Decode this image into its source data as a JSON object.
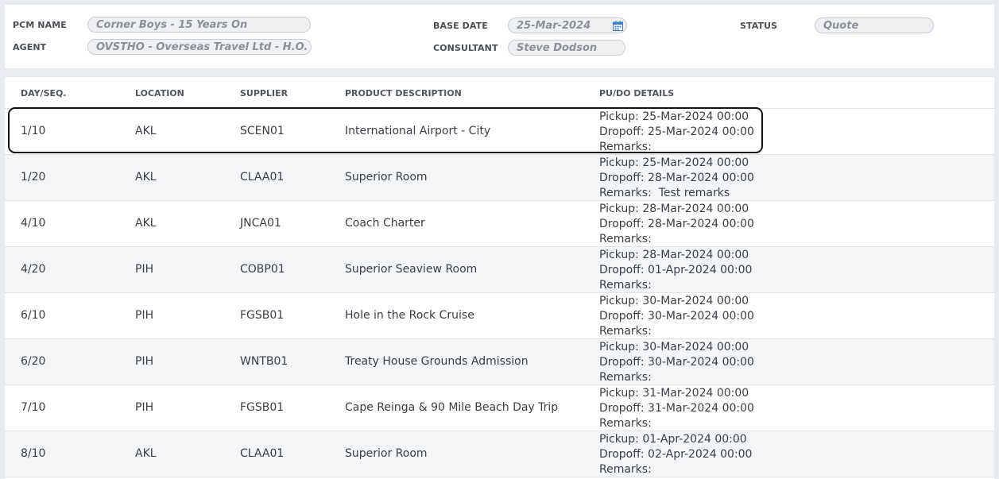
{
  "header": {
    "pcm_name_label": "PCM NAME",
    "pcm_name_value": "Corner Boys - 15 Years On",
    "agent_label": "AGENT",
    "agent_value": "OVSTHO - Overseas Travel Ltd - H.O.",
    "base_date_label": "BASE DATE",
    "base_date_value": "25-Mar-2024",
    "consultant_label": "CONSULTANT",
    "consultant_value": "Steve Dodson",
    "status_label": "STATUS",
    "status_value": "Quote"
  },
  "table": {
    "columns": [
      "DAY/SEQ.",
      "LOCATION",
      "SUPPLIER",
      "PRODUCT DESCRIPTION",
      "PU/DO DETAILS"
    ],
    "rows": [
      {
        "dayseq": "1/10",
        "location": "AKL",
        "supplier": "SCEN01",
        "product": "International Airport - City",
        "pickup": "Pickup: 25-Mar-2024 00:00",
        "dropoff": "Dropoff: 25-Mar-2024 00:00",
        "remarks": "Remarks:"
      },
      {
        "dayseq": "1/20",
        "location": "AKL",
        "supplier": "CLAA01",
        "product": "Superior Room",
        "pickup": "Pickup: 25-Mar-2024 00:00",
        "dropoff": "Dropoff: 28-Mar-2024 00:00",
        "remarks": "Remarks:  Test remarks"
      },
      {
        "dayseq": "4/10",
        "location": "AKL",
        "supplier": "JNCA01",
        "product": "Coach Charter",
        "pickup": "Pickup: 28-Mar-2024 00:00",
        "dropoff": "Dropoff: 28-Mar-2024 00:00",
        "remarks": "Remarks:"
      },
      {
        "dayseq": "4/20",
        "location": "PIH",
        "supplier": "COBP01",
        "product": "Superior Seaview Room",
        "pickup": "Pickup: 28-Mar-2024 00:00",
        "dropoff": "Dropoff: 01-Apr-2024 00:00",
        "remarks": "Remarks:"
      },
      {
        "dayseq": "6/10",
        "location": "PIH",
        "supplier": "FGSB01",
        "product": "Hole in the Rock Cruise",
        "pickup": "Pickup: 30-Mar-2024 00:00",
        "dropoff": "Dropoff: 30-Mar-2024 00:00",
        "remarks": "Remarks:"
      },
      {
        "dayseq": "6/20",
        "location": "PIH",
        "supplier": "WNTB01",
        "product": "Treaty House Grounds Admission",
        "pickup": "Pickup: 30-Mar-2024 00:00",
        "dropoff": "Dropoff: 30-Mar-2024 00:00",
        "remarks": "Remarks:"
      },
      {
        "dayseq": "7/10",
        "location": "PIH",
        "supplier": "FGSB01",
        "product": "Cape Reinga & 90 Mile Beach Day Trip",
        "pickup": "Pickup: 31-Mar-2024 00:00",
        "dropoff": "Dropoff: 31-Mar-2024 00:00",
        "remarks": "Remarks:"
      },
      {
        "dayseq": "8/10",
        "location": "AKL",
        "supplier": "CLAA01",
        "product": "Superior Room",
        "pickup": "Pickup: 01-Apr-2024 00:00",
        "dropoff": "Dropoff: 02-Apr-2024 00:00",
        "remarks": "Remarks:"
      }
    ]
  },
  "icons": {
    "calendar": "calendar-icon"
  },
  "colors": {
    "page_bg": "#e9ecef",
    "field_bg": "#eef0f2",
    "field_text": "#8a9097",
    "alt_row": "#f4f5f6",
    "calendar_blue": "#3d7cc9"
  }
}
